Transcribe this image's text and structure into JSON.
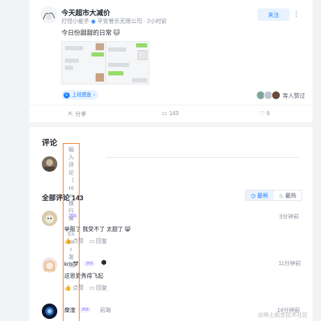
{
  "post": {
    "author": "今天超市大减价",
    "meta_author": "打怪小能手",
    "company": "平安普乐无限公司",
    "time": "2小时前",
    "follow_label": "关注",
    "more_icon": "more-dots-icon",
    "text": "今日份甜甜的日常",
    "topic_label": "上班摸鱼",
    "liked_suffix": "等人赞过",
    "share_label": "分享",
    "comment_count": "143",
    "like_count": "6"
  },
  "comments_section": {
    "title": "评论",
    "input_placeholder_chars": [
      "输",
      "入",
      "评",
      "论",
      "（",
      "nt",
      "er",
      "换",
      "行",
      "⌘",
      "+",
      "En",
      "te",
      "r",
      "发",
      "送"
    ],
    "all_title": "全部评论 143",
    "tab_newest": "最新",
    "tab_hottest": "最热",
    "like_label": "点赞",
    "reply_label": "回复",
    "level_badge": "JY.5",
    "comments": [
      {
        "user": "",
        "badge": "JY.5",
        "text": "举报了 我受不了 太甜了",
        "time": "3分钟前"
      },
      {
        "user": "kris梦",
        "badge": "JY.5",
        "text": "这恩爱秀得飞起",
        "time": "11分钟前"
      },
      {
        "user": "糜溲",
        "badge": "JY.5",
        "role": "前端",
        "text": "",
        "time": "14分钟前"
      }
    ]
  },
  "watermark": "@稀土掘金技术社区",
  "colors": {
    "accent": "#1e80ff",
    "input_border": "#f07c24",
    "badge": "#8b72ff"
  }
}
